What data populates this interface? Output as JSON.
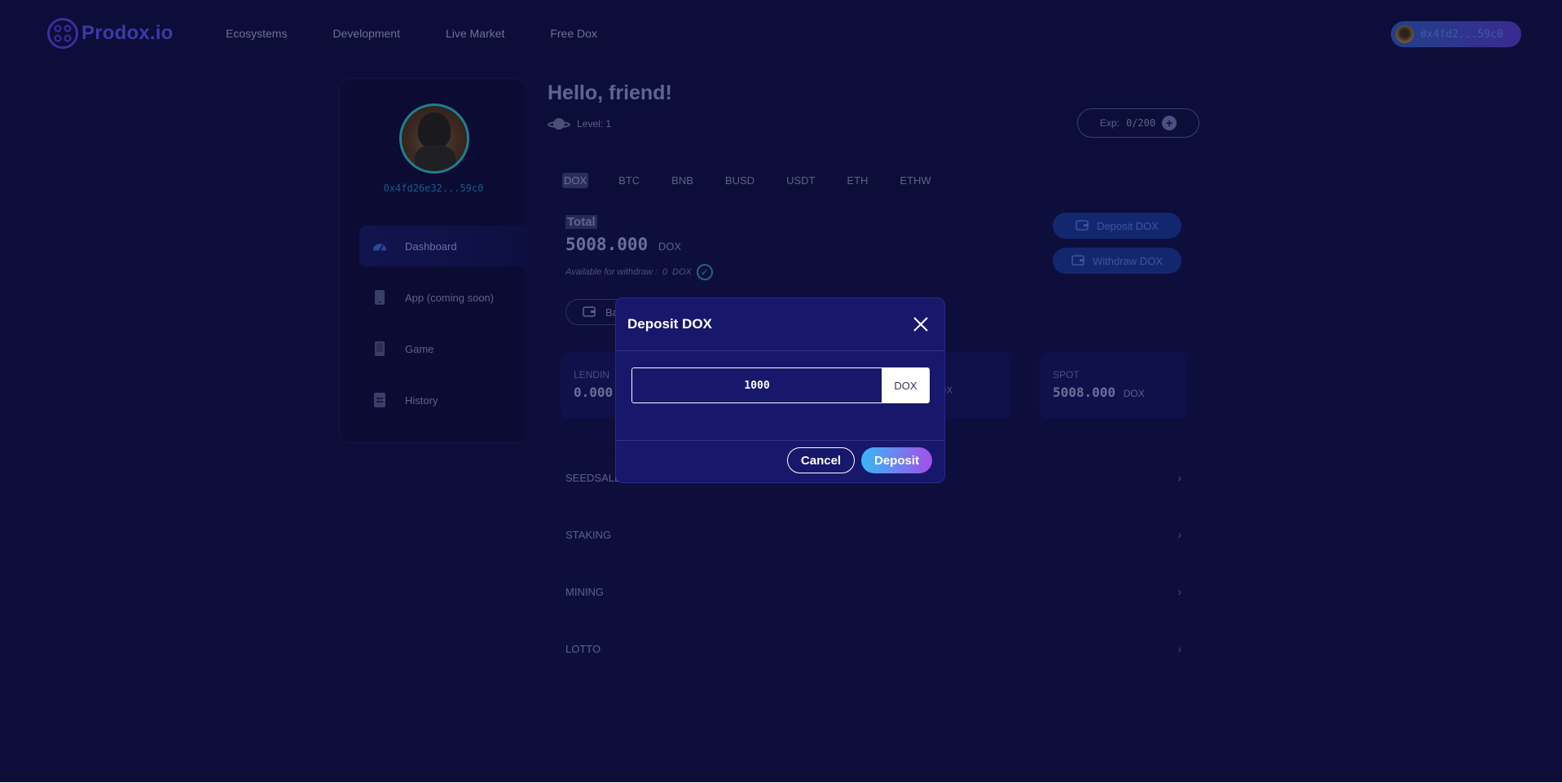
{
  "header": {
    "brand": "Prodox.io",
    "nav": [
      "Ecosystems",
      "Development",
      "Live Market",
      "Free Dox"
    ],
    "wallet_address": "0x4fd2...59c0"
  },
  "sidebar": {
    "address": "0x4fd26e32...59c0",
    "items": [
      {
        "label": "Dashboard",
        "icon": "speedometer-icon"
      },
      {
        "label": "App (coming soon)",
        "icon": "phone-icon"
      },
      {
        "label": "Game",
        "icon": "tablet-icon"
      },
      {
        "label": "History",
        "icon": "document-icon"
      }
    ]
  },
  "main": {
    "greeting": "Hello, friend!",
    "level": "Level: 1",
    "exp_label": "Exp:",
    "exp_value": "0/200",
    "tabs": [
      "DOX",
      "BTC",
      "BNB",
      "BUSD",
      "USDT",
      "ETH",
      "ETHW"
    ],
    "total_label": "Total",
    "total_value": "5008.000",
    "total_unit": "DOX",
    "available_label": "Available for withdraw :",
    "available_value": "0",
    "available_unit": "DOX",
    "deposit_button": "Deposit DOX",
    "withdraw_button": "Withdraw DOX",
    "balance_button_partial": "Ba",
    "stats": [
      {
        "label": "LENDIN",
        "value": "0.000",
        "unit": ""
      },
      {
        "label": "",
        "value": "",
        "unit": "OX"
      },
      {
        "label": "SPOT",
        "value": "5008.000",
        "unit": "DOX"
      }
    ],
    "accordions": [
      "SEEDSALE",
      "STAKING",
      "MINING",
      "LOTTO"
    ]
  },
  "modal": {
    "title": "Deposit DOX",
    "amount": "1000",
    "unit": "DOX",
    "cancel_label": "Cancel",
    "deposit_label": "Deposit"
  },
  "colors": {
    "background": "#0d0d3a",
    "modal_bg": "#17176b",
    "deposit_gradient_start": "#36b8f5",
    "deposit_gradient_end": "#a34fe8"
  }
}
